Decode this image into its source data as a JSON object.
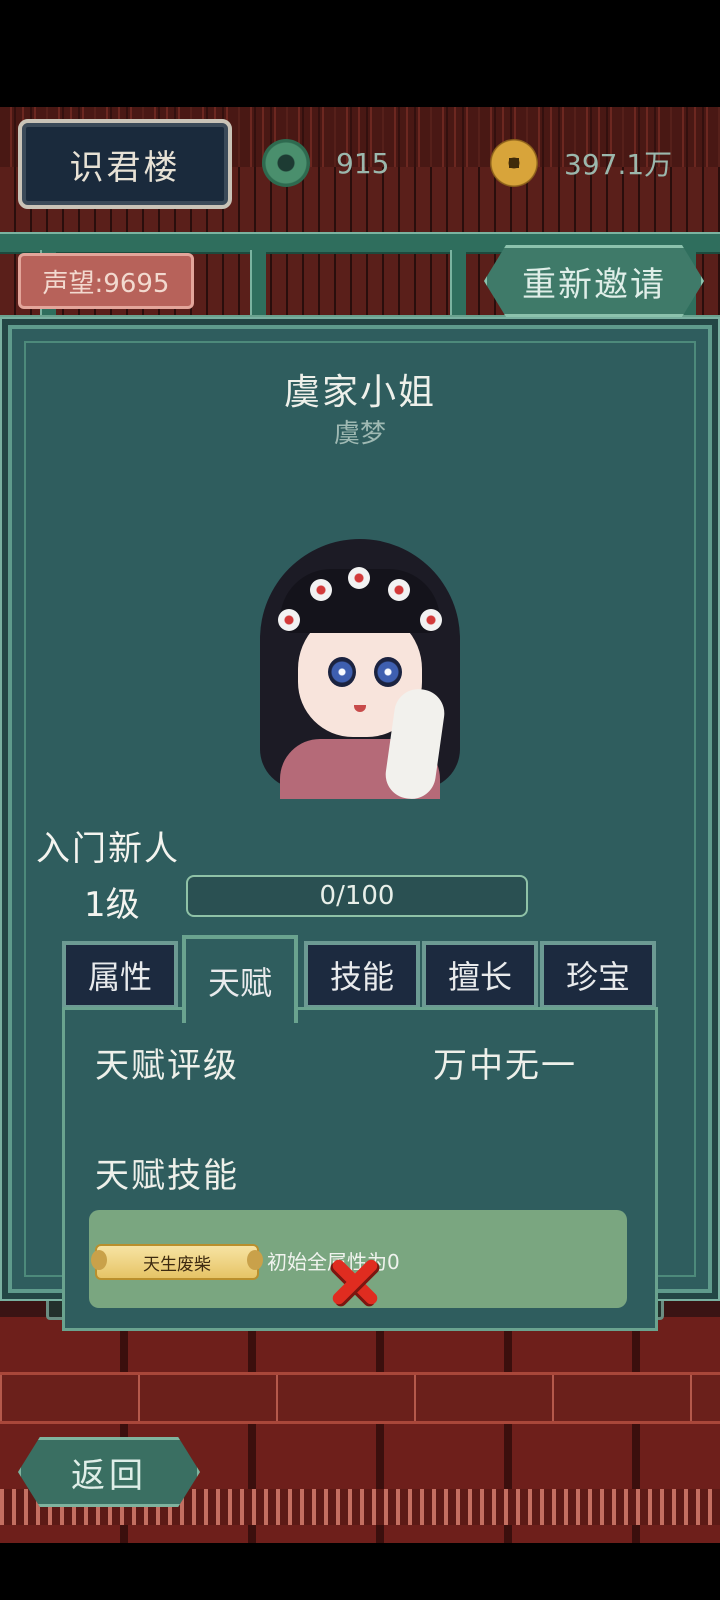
{
  "header": {
    "title": "识君楼",
    "jade_amount": "915",
    "coin_amount": "397.1万",
    "fame": "声望:9695",
    "reinvite_label": "重新邀请"
  },
  "character": {
    "title": "虞家小姐",
    "name": "虞梦",
    "rank": "入门新人",
    "level": "1级",
    "exp": "0/100"
  },
  "tabs": [
    {
      "label": "属性",
      "active": false
    },
    {
      "label": "天赋",
      "active": true
    },
    {
      "label": "技能",
      "active": false
    },
    {
      "label": "擅长",
      "active": false
    },
    {
      "label": "珍宝",
      "active": false
    }
  ],
  "talent": {
    "rating_label": "天赋评级",
    "rating_value": "万中无一",
    "skills_label": "天赋技能",
    "skill_name": "天生废柴",
    "skill_desc": "初始全属性为0"
  },
  "footer": {
    "back_label": "返回"
  },
  "colors": {
    "panel": "#2f5d5e",
    "accent": "#6aa38f",
    "close": "#e02c20"
  }
}
